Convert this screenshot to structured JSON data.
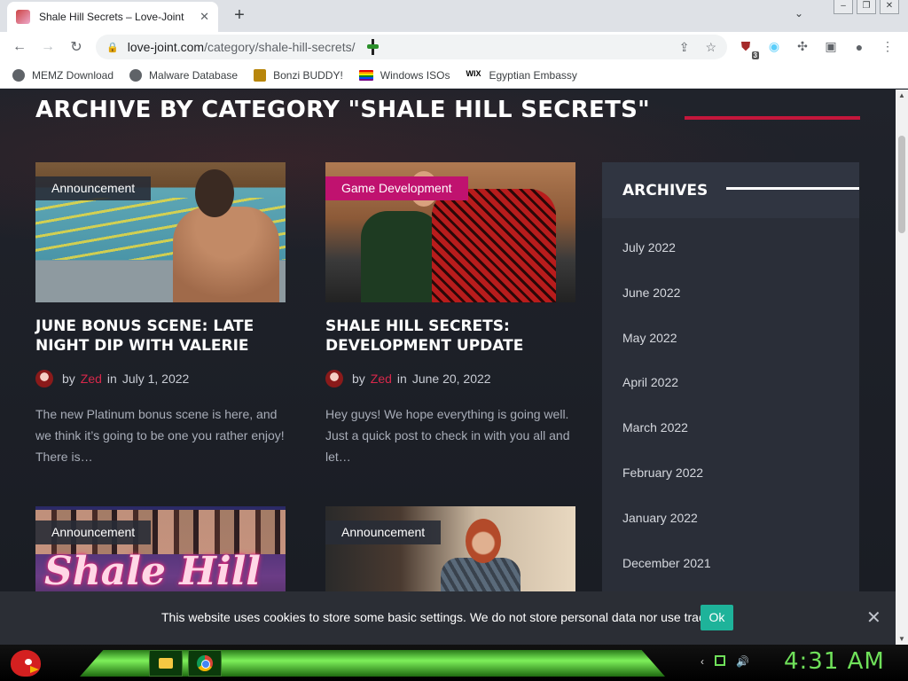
{
  "browser": {
    "tab_title": "Shale Hill Secrets – Love-Joint",
    "tab_close": "✕",
    "new_tab": "+",
    "tab_search": "⌄",
    "window_controls": [
      "–",
      "❐",
      "✕"
    ],
    "url_host": "love-joint.com",
    "url_path": "/category/shale-hill-secrets/",
    "ext_badge_count": "3",
    "bookmarks": [
      {
        "label": "MEMZ Download",
        "icon": "globe-icon"
      },
      {
        "label": "Malware Database",
        "icon": "globe-icon"
      },
      {
        "label": "Bonzi BUDDY!",
        "icon": "bonzi-icon"
      },
      {
        "label": "Windows ISOs",
        "icon": "rainbow-flag-icon"
      },
      {
        "label": "Egyptian Embassy",
        "icon": "wix-icon"
      }
    ]
  },
  "page": {
    "archive_title": "ARCHIVE BY CATEGORY \"SHALE HILL SECRETS\"",
    "accent_color": "#c4163b",
    "posts": [
      {
        "category": "Announcement",
        "title": "JUNE BONUS SCENE: LATE NIGHT DIP WITH VALERIE",
        "by": "by",
        "author": "Zed",
        "in": "in",
        "date": "July 1, 2022",
        "excerpt": "The new Platinum bonus scene is here, and we think it’s going to be one you rather enjoy! There is…"
      },
      {
        "category": "Game Development",
        "title": "SHALE HILL SECRETS: DEVELOPMENT UPDATE",
        "by": "by",
        "author": "Zed",
        "in": "in",
        "date": "June 20, 2022",
        "excerpt": "Hey guys! We hope everything is going well. Just a quick post to check in with you all and let…"
      },
      {
        "category": "Announcement",
        "logo_text": "Shale Hill"
      },
      {
        "category": "Announcement"
      }
    ],
    "sidebar": {
      "heading": "ARCHIVES",
      "items": [
        "July 2022",
        "June 2022",
        "May 2022",
        "April 2022",
        "March 2022",
        "February 2022",
        "January 2022",
        "December 2021"
      ]
    }
  },
  "cookie_banner": {
    "message": "This website uses cookies to store some basic settings. We do not store personal data nor use trackers.",
    "ok_label": "Ok",
    "close": "✕"
  },
  "taskbar": {
    "clock": "4:31 AM"
  }
}
